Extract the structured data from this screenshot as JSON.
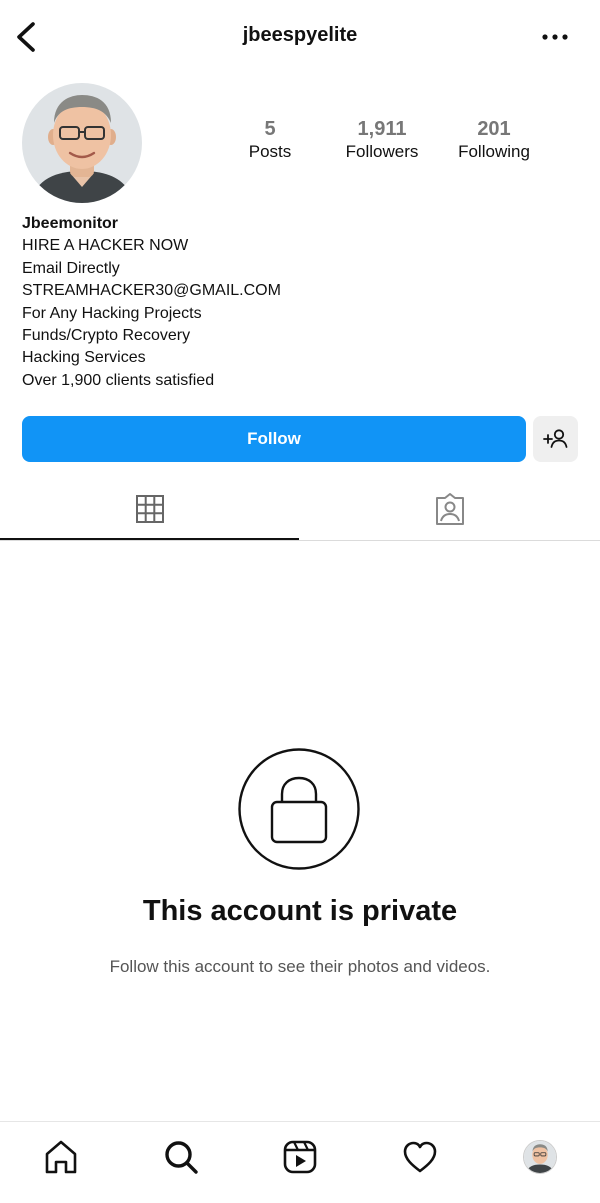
{
  "header": {
    "username": "jbeespyelite",
    "back_icon": "chevron-left-icon",
    "more_icon": "ellipsis-icon"
  },
  "profile": {
    "avatar": "profile-photo",
    "stats": [
      {
        "value": "5",
        "label": "Posts"
      },
      {
        "value": "1,911",
        "label": "Followers"
      },
      {
        "value": "201",
        "label": "Following"
      }
    ],
    "display_name": "Jbeemonitor",
    "bio_lines": [
      "HIRE A HACKER NOW",
      "Email Directly",
      "STREAMHACKER30@GMAIL.COM",
      "For Any Hacking Projects",
      "Funds/Crypto Recovery",
      "Hacking Services",
      "Over 1,900 clients satisfied"
    ]
  },
  "actions": {
    "follow_label": "Follow",
    "suggest_icon": "add-person-icon"
  },
  "tabs": [
    {
      "icon": "grid-icon",
      "active": true
    },
    {
      "icon": "tagged-icon",
      "active": false
    }
  ],
  "private": {
    "icon": "lock-icon",
    "title": "This account is private",
    "subtitle": "Follow this account to see their photos and videos."
  },
  "bottom_nav": [
    "home-icon",
    "search-icon",
    "reels-icon",
    "heart-icon",
    "profile-avatar"
  ],
  "colors": {
    "accent": "#1194f6",
    "stat_number": "#777777",
    "secondary_button": "#efefef"
  }
}
